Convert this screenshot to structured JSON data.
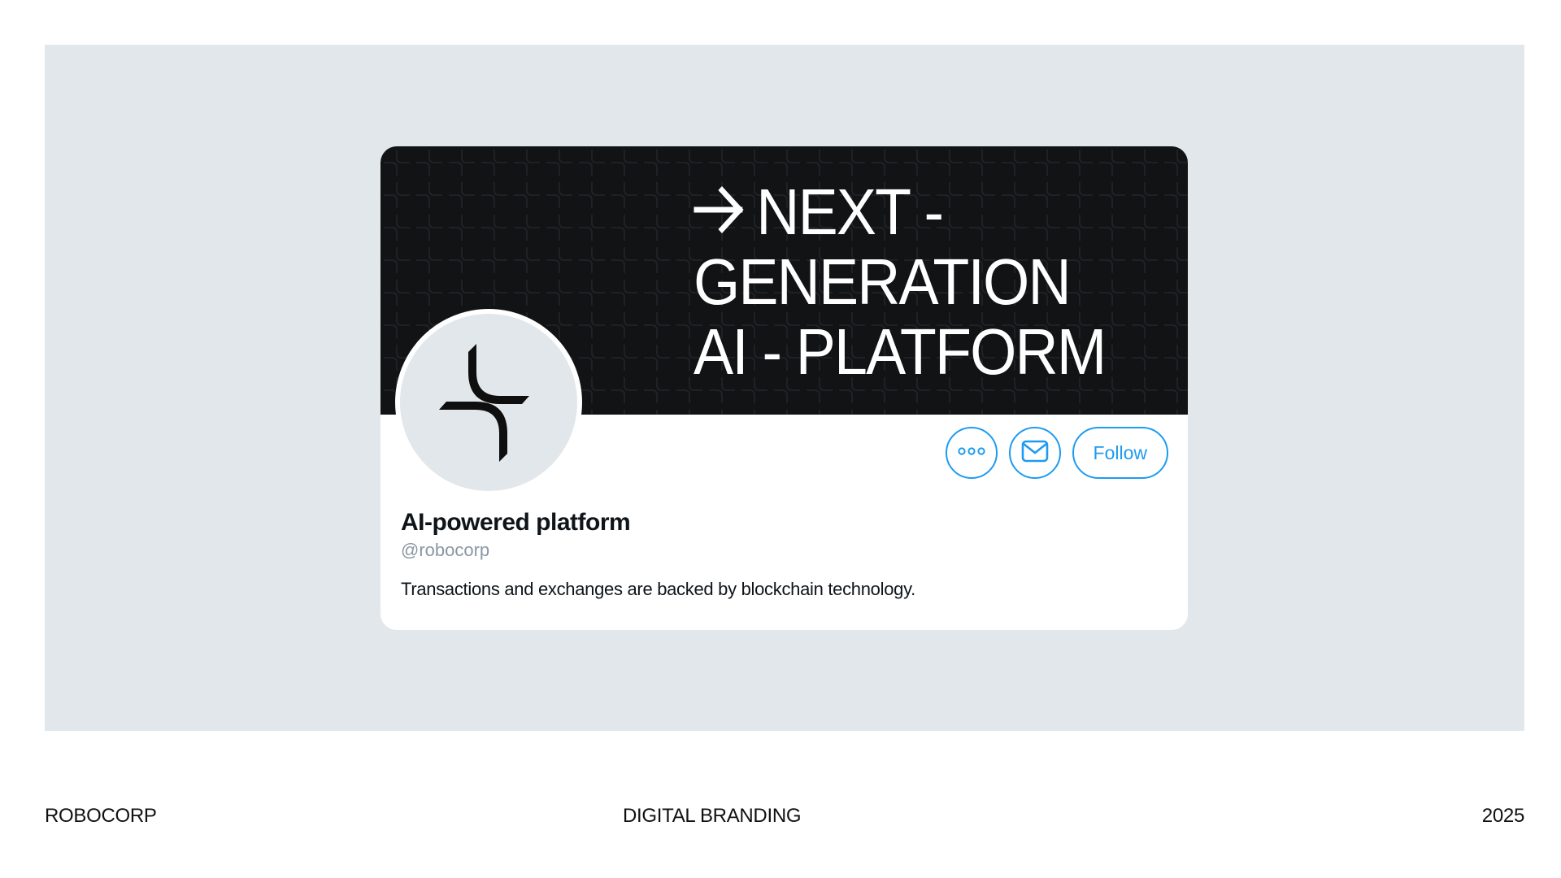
{
  "banner": {
    "headline_lines": [
      "NEXT -",
      "GENERATION",
      "AI - PLATFORM"
    ],
    "arrow_icon": "arrow-right-icon"
  },
  "profile": {
    "avatar_icon": "robocorp-logo-icon",
    "name": "AI-powered platform",
    "handle": "@robocorp",
    "bio": "Transactions and exchanges are backed by blockchain technology."
  },
  "actions": {
    "more_icon": "more-options-icon",
    "message_icon": "envelope-icon",
    "follow_label": "Follow"
  },
  "footer": {
    "left": "ROBOCORP",
    "center": "DIGITAL BRANDING",
    "right": "2025"
  },
  "colors": {
    "stage_background": "#e1e7ea",
    "banner_background": "#121315",
    "accent": "#1d9bf0",
    "handle_gray": "#8a97a3"
  }
}
